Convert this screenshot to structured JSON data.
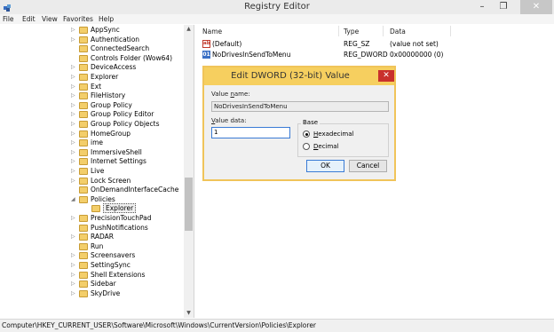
{
  "window": {
    "title": "Registry Editor",
    "minimize_glyph": "–",
    "maximize_glyph": "❐",
    "close_glyph": "✕"
  },
  "menu": [
    "File",
    "Edit",
    "View",
    "Favorites",
    "Help"
  ],
  "tree": {
    "items": [
      {
        "label": "AppSync",
        "expandable": true
      },
      {
        "label": "Authentication",
        "expandable": true
      },
      {
        "label": "ConnectedSearch",
        "expandable": false
      },
      {
        "label": "Controls Folder (Wow64)",
        "expandable": false
      },
      {
        "label": "DeviceAccess",
        "expandable": true
      },
      {
        "label": "Explorer",
        "expandable": true
      },
      {
        "label": "Ext",
        "expandable": true
      },
      {
        "label": "FileHistory",
        "expandable": true
      },
      {
        "label": "Group Policy",
        "expandable": true
      },
      {
        "label": "Group Policy Editor",
        "expandable": true
      },
      {
        "label": "Group Policy Objects",
        "expandable": true
      },
      {
        "label": "HomeGroup",
        "expandable": true
      },
      {
        "label": "ime",
        "expandable": true
      },
      {
        "label": "ImmersiveShell",
        "expandable": true
      },
      {
        "label": "Internet Settings",
        "expandable": true
      },
      {
        "label": "Live",
        "expandable": true
      },
      {
        "label": "Lock Screen",
        "expandable": true
      },
      {
        "label": "OnDemandInterfaceCache",
        "expandable": false
      },
      {
        "label": "Policies",
        "expandable": true,
        "expanded": true
      },
      {
        "label": "Explorer",
        "child": true,
        "selected": true
      },
      {
        "label": "PrecisionTouchPad",
        "expandable": true
      },
      {
        "label": "PushNotifications",
        "expandable": false
      },
      {
        "label": "RADAR",
        "expandable": true
      },
      {
        "label": "Run",
        "expandable": false
      },
      {
        "label": "Screensavers",
        "expandable": true
      },
      {
        "label": "SettingSync",
        "expandable": true
      },
      {
        "label": "Shell Extensions",
        "expandable": true
      },
      {
        "label": "Sidebar",
        "expandable": true
      },
      {
        "label": "SkyDrive",
        "expandable": true
      }
    ]
  },
  "values": {
    "columns": [
      "Name",
      "Type",
      "Data"
    ],
    "rows": [
      {
        "icon": "string-value-icon",
        "icon_glyph": "ab",
        "name": "(Default)",
        "type": "REG_SZ",
        "data": "(value not set)"
      },
      {
        "icon": "binary-value-icon",
        "icon_glyph": "01",
        "name": "NoDrivesInSendToMenu",
        "type": "REG_DWORD",
        "data": "0x00000000 (0)"
      }
    ]
  },
  "dialog": {
    "title": "Edit DWORD (32-bit) Value",
    "value_name_label_pre": "Value ",
    "value_name_label_u": "n",
    "value_name_label_post": "ame:",
    "value_name": "NoDrivesInSendToMenu",
    "value_data_label_u": "V",
    "value_data_label_post": "alue data:",
    "value_data": "1",
    "base_label": "Base",
    "hex_u": "H",
    "hex_post": "exadecimal",
    "dec_u": "D",
    "dec_post": "ecimal",
    "base_selected": "Hexadecimal",
    "ok_label": "OK",
    "cancel_label": "Cancel",
    "close_glyph": "✕"
  },
  "status_path": "Computer\\HKEY_CURRENT_USER\\Software\\Microsoft\\Windows\\CurrentVersion\\Policies\\Explorer",
  "colors": {
    "dialog_accent": "#f6cf5f",
    "folder": "#f3ce6a",
    "close_red": "#c9302c"
  }
}
